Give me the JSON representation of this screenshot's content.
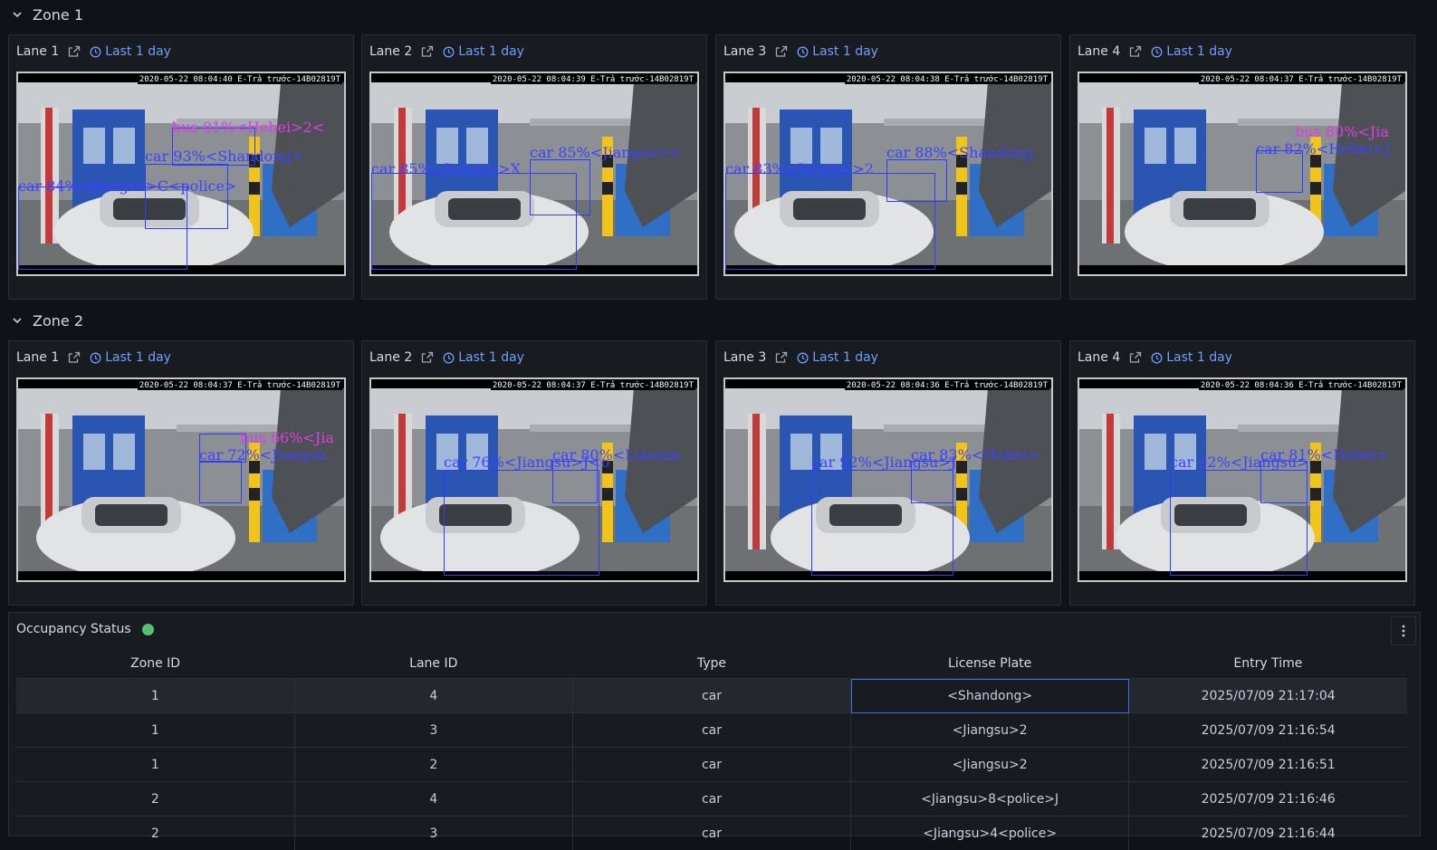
{
  "zones": [
    {
      "title": "Zone 1",
      "lanes": [
        {
          "title": "Lane 1",
          "time": "Last 1 day",
          "timestamp": "2020-05-22 08:04:40 E-Trả trước-14B02819T",
          "labels": [
            "bus 81%<Hebei>2<",
            "car 93%<Shandong>",
            "car 84%<Jiangsu>C<police>"
          ]
        },
        {
          "title": "Lane 2",
          "time": "Last 1 day",
          "timestamp": "2020-05-22 08:04:39 E-Trả trước-14B02819T",
          "labels": [
            "car 85%<Jiangsu><",
            "car 85%<Jiangsu>X"
          ]
        },
        {
          "title": "Lane 3",
          "time": "Last 1 day",
          "timestamp": "2020-05-22 08:04:38 E-Trả trước-14B02819T",
          "labels": [
            "car 88%<Shandong",
            "car 83%<Jiangsu>2"
          ]
        },
        {
          "title": "Lane 4",
          "time": "Last 1 day",
          "timestamp": "2020-05-22 08:04:37 E-Trả trước-14B02819T",
          "labels": [
            "bus 80%<Jia",
            "car 82%<Hebei>J"
          ]
        }
      ]
    },
    {
      "title": "Zone 2",
      "lanes": [
        {
          "title": "Lane 1",
          "time": "Last 1 day",
          "timestamp": "2020-05-22 08:04:37 E-Trả trước-14B02819T",
          "labels": [
            "bus 66%<Jia",
            "car 72%<Jiangsu"
          ]
        },
        {
          "title": "Lane 2",
          "time": "Last 1 day",
          "timestamp": "2020-05-22 08:04:37 E-Trả trước-14B02819T",
          "labels": [
            "car 80%<Liaonin",
            "car 76%<Jiangsu>J<o"
          ]
        },
        {
          "title": "Lane 3",
          "time": "Last 1 day",
          "timestamp": "2020-05-22 08:04:36 E-Trả trước-14B02819T",
          "labels": [
            "car 83%<Hebei>",
            "car 92%<Jiangsu>J"
          ]
        },
        {
          "title": "Lane 4",
          "time": "Last 1 day",
          "timestamp": "2020-05-22 08:04:36 E-Trả trước-14B02819T",
          "labels": [
            "car 81%<Hebei>",
            "car 92%<Jiangsu>"
          ]
        }
      ]
    }
  ],
  "occupancy": {
    "title": "Occupancy Status",
    "status_color": "#56c271",
    "columns": [
      "Zone ID",
      "Lane ID",
      "Type",
      "License Plate",
      "Entry Time"
    ],
    "rows": [
      [
        "1",
        "4",
        "car",
        "<Shandong>",
        "2025/07/09 21:17:04"
      ],
      [
        "1",
        "3",
        "car",
        "<Jiangsu>2",
        "2025/07/09 21:16:54"
      ],
      [
        "1",
        "2",
        "car",
        "<Jiangsu>2",
        "2025/07/09 21:16:51"
      ],
      [
        "2",
        "4",
        "car",
        "<Jiangsu>8<police>J",
        "2025/07/09 21:16:46"
      ],
      [
        "2",
        "3",
        "car",
        "<Jiangsu>4<police>",
        "2025/07/09 21:16:44"
      ]
    ]
  }
}
